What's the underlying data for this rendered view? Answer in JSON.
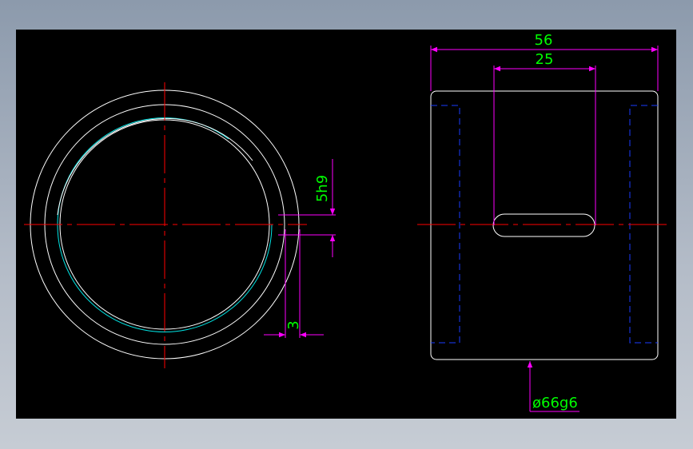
{
  "colors": {
    "outline": "#ffffff",
    "centerline": "#ff0000",
    "dimension": "#ff00ff",
    "dimension_text": "#00ff00",
    "hidden": "#1a3cff",
    "thread": "#00e5e5",
    "frame_background": "#000000"
  },
  "dimensions": {
    "overall_width": "56",
    "slot_length": "25",
    "keyway_width": "5h9",
    "wall": "3",
    "outer_diameter": "ø66g6"
  }
}
